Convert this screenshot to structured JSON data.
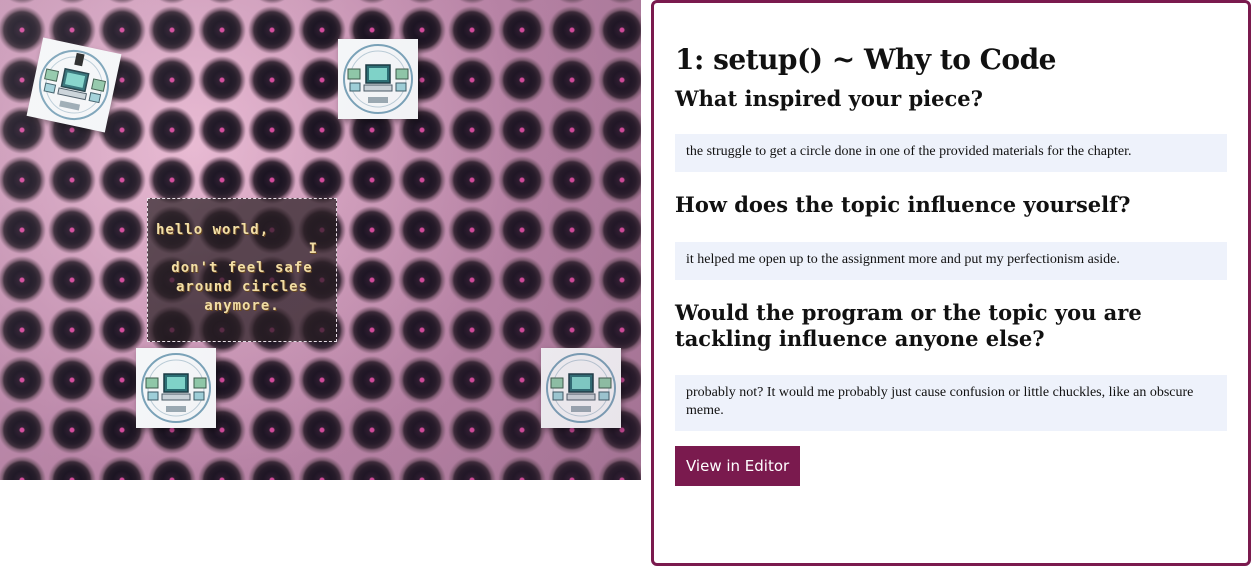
{
  "sketch": {
    "message_lines": [
      "hello world,",
      "I",
      "don't feel safe",
      "around circles",
      "anymore."
    ],
    "badge_icon": "computer-clipart-badge-icon"
  },
  "card": {
    "title": "1: setup() ~ Why to Code",
    "questions": [
      {
        "question": "What inspired your piece?",
        "answer": "the struggle to get a circle done in one of the provided materials for the chapter."
      },
      {
        "question": "How does the topic influence yourself?",
        "answer": "it helped me open up to the assignment more and put my perfectionism aside."
      },
      {
        "question": "Would the program or the topic you are tackling influence anyone else?",
        "answer": "probably not? It would me probably just cause confusion or little chuckles, like an obscure meme."
      }
    ],
    "button_label": "View in Editor"
  },
  "colors": {
    "accent": "#7a1a4e",
    "answer_background": "#eef2fb",
    "message_text": "#f2dfa6"
  }
}
